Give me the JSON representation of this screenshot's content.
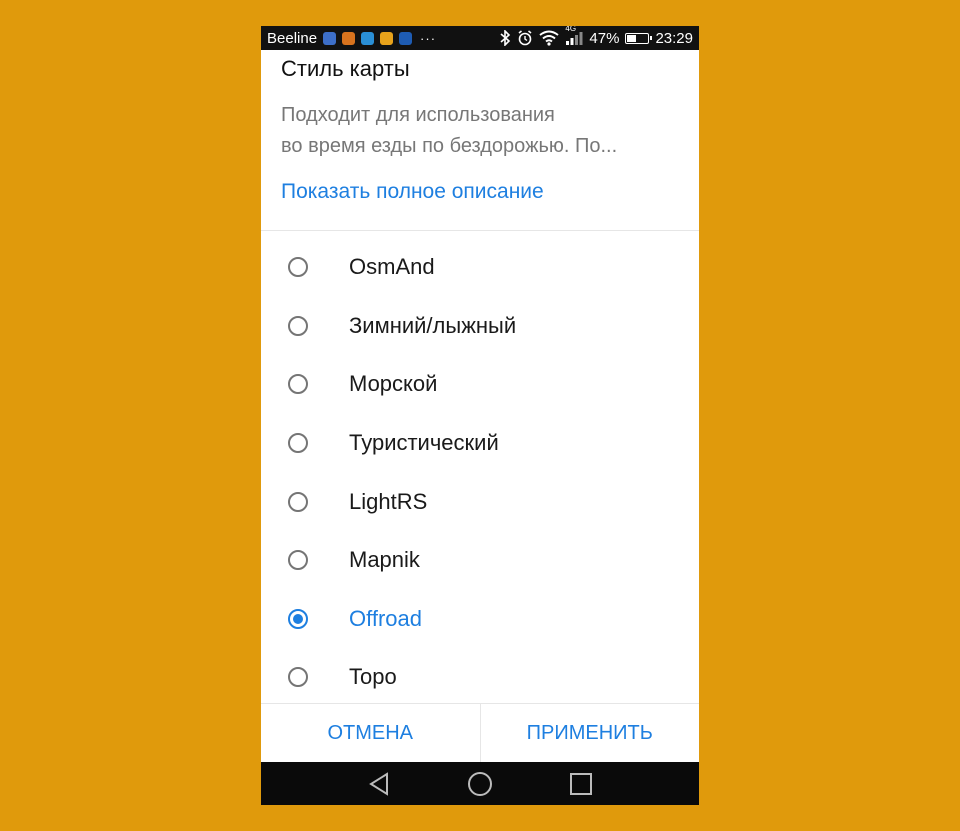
{
  "status_bar": {
    "carrier": "Beeline",
    "network": "4G",
    "battery_percent": "47%",
    "battery_level": 0.47,
    "time": "23:29",
    "overflow": "···",
    "app_icon_colors": [
      "#3D6FC9",
      "#D8731E",
      "#2A8FD6",
      "#E7A21B",
      "#1E5CB3"
    ]
  },
  "dialog": {
    "title": "Стиль карты",
    "description_line1": "Подходит для использования",
    "description_line2": "во время езды по бездорожью.  По...",
    "show_more": "Показать полное описание",
    "options": [
      {
        "label": "OsmAnd",
        "selected": false
      },
      {
        "label": "Зимний/лыжный",
        "selected": false
      },
      {
        "label": "Морской",
        "selected": false
      },
      {
        "label": "Туристический",
        "selected": false
      },
      {
        "label": "LightRS",
        "selected": false
      },
      {
        "label": "Mapnik",
        "selected": false
      },
      {
        "label": "Offroad",
        "selected": true
      },
      {
        "label": "Topo",
        "selected": false
      }
    ],
    "cancel_label": "ОТМЕНА",
    "apply_label": "ПРИМЕНИТЬ"
  },
  "navigation_bar": {
    "back_icon": "back-triangle-icon",
    "home_icon": "home-circle-icon",
    "recents_icon": "recents-square-icon"
  },
  "colors": {
    "background": "#E09A0C",
    "accent": "#1E7FE0"
  }
}
